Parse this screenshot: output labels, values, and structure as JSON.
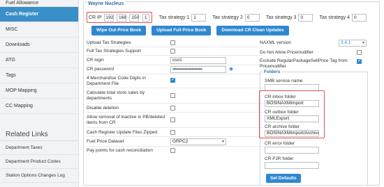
{
  "sidebar": {
    "items": [
      {
        "label": "Fuel Allowance"
      },
      {
        "label": "Cash Register"
      },
      {
        "label": "MISC"
      },
      {
        "label": "Downloads"
      },
      {
        "label": "ATG"
      },
      {
        "label": "Tags"
      },
      {
        "label": "MOP Mapping"
      },
      {
        "label": "CC Mapping"
      }
    ],
    "related_title": "Related Links",
    "links": [
      {
        "label": "Department Taxes"
      },
      {
        "label": "Department Product Codes"
      },
      {
        "label": "Station Options Changes Log"
      }
    ]
  },
  "main": {
    "section_title": "Wayne Nucleus",
    "cr_ip_label": "CR IP",
    "cr_ip": [
      "192",
      "168",
      "150",
      "1"
    ],
    "tax_strategies": [
      {
        "label": "Tax strategy 1",
        "value": "1"
      },
      {
        "label": "Tax strategy 2",
        "value": "0"
      },
      {
        "label": "Tax strategy 3",
        "value": "0"
      },
      {
        "label": "Tax strategy 4",
        "value": "0"
      }
    ],
    "buttons": {
      "wipe": "Wipe Out Price Book",
      "upload": "Upload Full Price Book",
      "download": "Download CR Clean Updates"
    },
    "left_fields": {
      "upload_tax": "Upload Tax Strategies",
      "full_tax": "Full Tax Strategies Support",
      "cr_login": "CR login",
      "cr_login_value": "cso1",
      "cr_password": "CR password",
      "cr_password_value": "••••••••••••••••••••••••••••••••••",
      "merch4_line1": "4 Merchandise Code Digits in",
      "merch4_line2": "Department File",
      "calc_line1": "Calculate total store sales by",
      "calc_line2": "departments",
      "disable_del": "Disable deletion",
      "allow_rem_line1": "Allow removal of inactive in PB/deleted",
      "allow_rem_line2": "items from CR",
      "cr_update": "Cash Register Update Files Zipped",
      "fuel_price": "Fuel Price Dataset",
      "fuel_price_value": "GRPC2",
      "pay_points": "Pay points for cash reconciliation"
    },
    "right_fields": {
      "naxml": "NAXML version",
      "naxml_value": "3.4.1",
      "no_price": "Do Not Allow Pricemodifier",
      "exclude_line1": "Exclude RegularPackageSellPrice Tag from",
      "exclude_line2": "Pricemodifier"
    },
    "folders": {
      "title": "Folders",
      "smb": "SMB service name",
      "smb_value": "",
      "inbox": "CR inbox folder",
      "inbox_value": "BOSINAXMImport",
      "outbox": "CR outbox folder",
      "outbox_value": "XMLExport",
      "archive": "CR archive folder",
      "archive_value": "BOSINAXMImport/Archive",
      "error": "CR error folder",
      "error_value": "",
      "pjr": "CR PJR folder",
      "pjr_value": "",
      "set_defaults": "Set Defaults"
    }
  },
  "colors": {
    "accent": "#2f87d0",
    "active_sidebar": "#3a8fc8",
    "highlight": "#e0524e"
  }
}
